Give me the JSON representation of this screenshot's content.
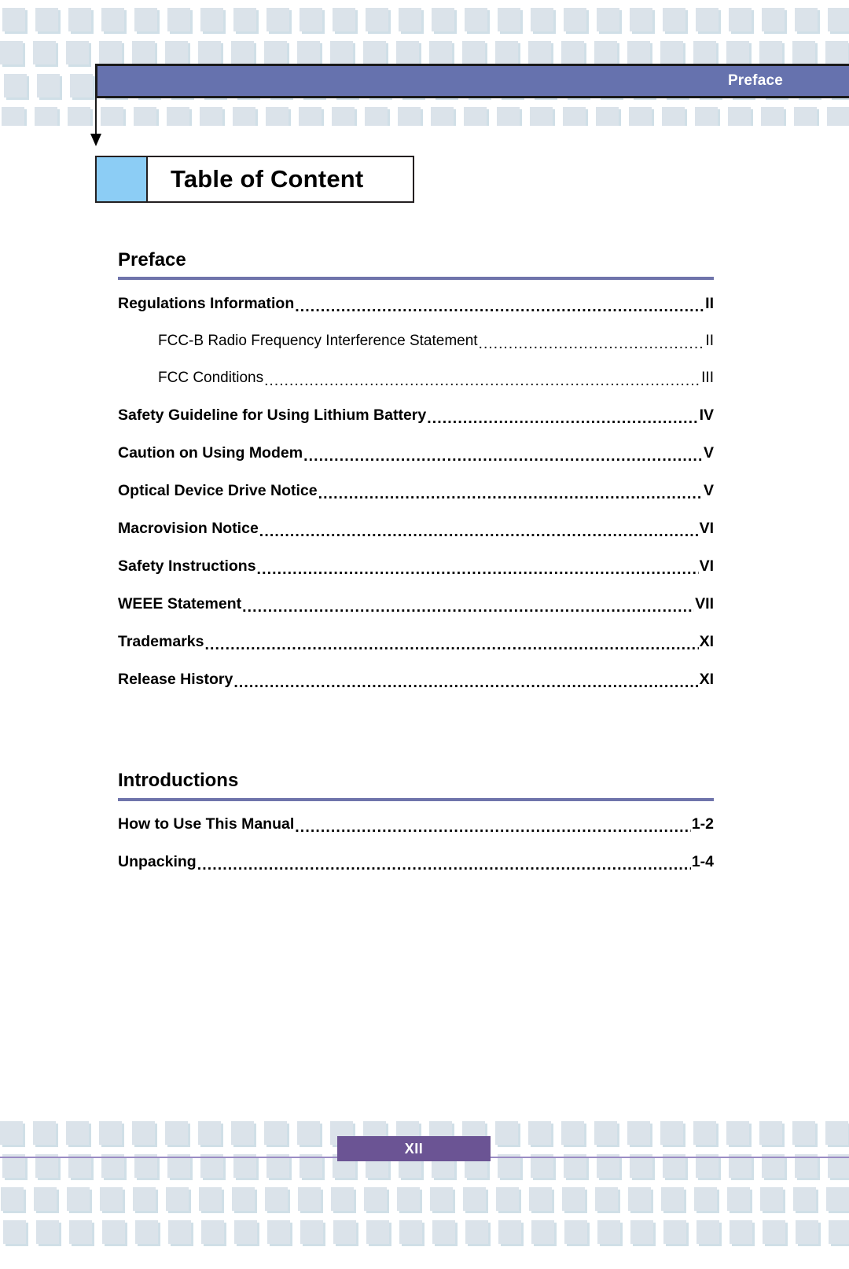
{
  "header": {
    "label": "Preface"
  },
  "title_box": {
    "title": "Table of Content",
    "swatch_color": "#8ccdf5"
  },
  "colors": {
    "header_bar": "#6672ae",
    "section_rule": "#6f74ab",
    "footer_bar": "#6b5494",
    "footer_rule": "#9b8cc4",
    "pattern_square": "#dbe3ea"
  },
  "sections": [
    {
      "heading": "Preface",
      "entries": [
        {
          "text": "Regulations Information",
          "page": "II",
          "level": 1
        },
        {
          "text": "FCC-B Radio Frequency Interference Statement",
          "page": "II",
          "level": 2
        },
        {
          "text": "FCC Conditions",
          "page": "III",
          "level": 2
        },
        {
          "text": "Safety Guideline for Using Lithium Battery",
          "page": "IV",
          "level": 1
        },
        {
          "text": "Caution on Using Modem",
          "page": "V",
          "level": 1
        },
        {
          "text": "Optical Device Drive Notice",
          "page": "V",
          "level": 1
        },
        {
          "text": "Macrovision Notice",
          "page": "VI",
          "level": 1
        },
        {
          "text": "Safety Instructions",
          "page": "VI",
          "level": 1
        },
        {
          "text": "WEEE Statement",
          "page": "VII",
          "level": 1
        },
        {
          "text": "Trademarks",
          "page": "XI",
          "level": 1
        },
        {
          "text": "Release History",
          "page": "XI",
          "level": 1
        }
      ]
    },
    {
      "heading": "Introductions",
      "entries": [
        {
          "text": "How to Use This Manual",
          "page": "1-2",
          "level": 1
        },
        {
          "text": "Unpacking",
          "page": "1-4",
          "level": 1
        }
      ]
    }
  ],
  "footer": {
    "page_number": "XII"
  }
}
